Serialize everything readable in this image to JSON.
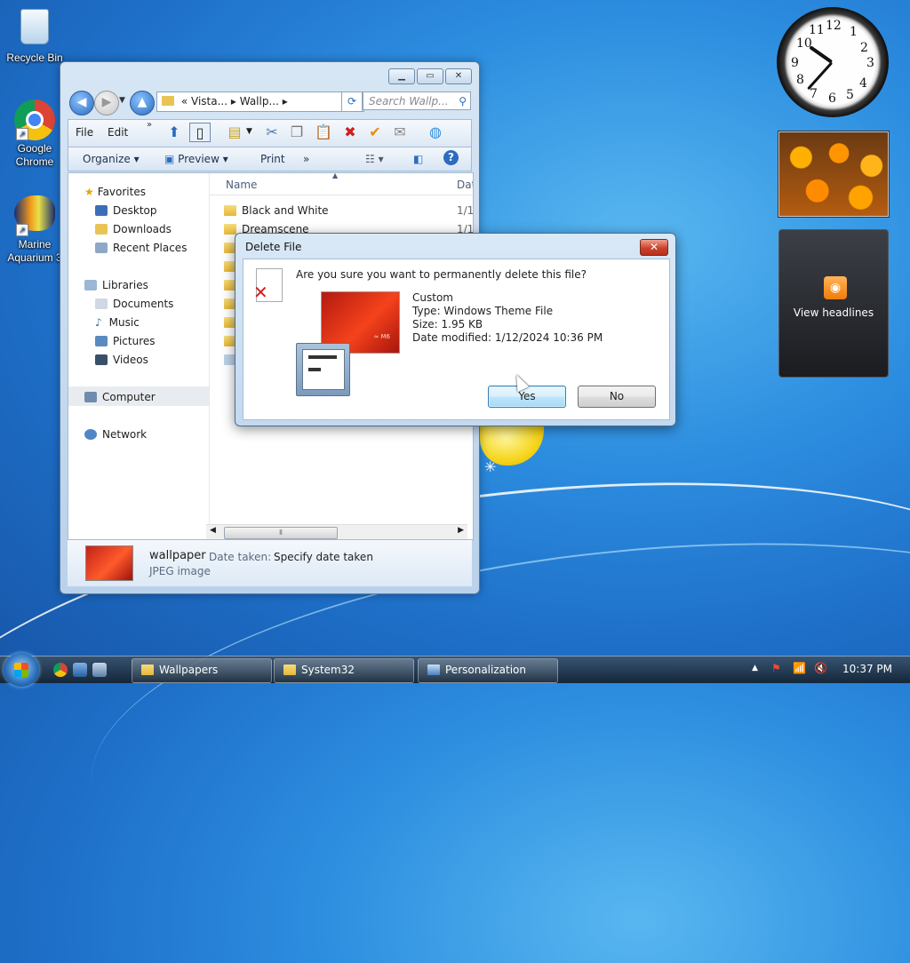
{
  "desktop": {
    "icons": [
      {
        "label": "Recycle Bin"
      },
      {
        "label": "Google Chrome"
      },
      {
        "label": "Marine Aquarium 3"
      }
    ]
  },
  "explorer": {
    "address_parts": [
      "«",
      "Vista...",
      "▸",
      "Wallp...",
      "▸"
    ],
    "search_placeholder": "Search Wallp...",
    "menu": {
      "file": "File",
      "edit": "Edit"
    },
    "commands": {
      "organize": "Organize",
      "preview": "Preview",
      "print": "Print",
      "more": "»"
    },
    "nav": {
      "favorites": "Favorites",
      "favorite_items": [
        "Desktop",
        "Downloads",
        "Recent Places"
      ],
      "libraries": "Libraries",
      "library_items": [
        "Documents",
        "Music",
        "Pictures",
        "Videos"
      ],
      "computer": "Computer",
      "network": "Network"
    },
    "columns": {
      "name": "Name",
      "date": "Dat"
    },
    "files": [
      {
        "name": "Black and White",
        "date": "1/1"
      },
      {
        "name": "Dreamscene",
        "date": "1/1"
      }
    ],
    "details": {
      "name": "wallpaper",
      "type": "JPEG image",
      "date_label": "Date taken:",
      "date_value": "Specify date taken"
    }
  },
  "dialog": {
    "title": "Delete File",
    "close": "✕",
    "question": "Are you sure you want to permanently delete this file?",
    "preview_text": "≈ M6",
    "file_name": "Custom",
    "type_line": "Type: Windows Theme File",
    "size_line": "Size: 1.95 KB",
    "date_line": "Date modified: 1/12/2024 10:36 PM",
    "yes": "Yes",
    "no": "No"
  },
  "gadgets": {
    "clock_numbers": [
      "12",
      "1",
      "2",
      "3",
      "4",
      "5",
      "6",
      "7",
      "8",
      "9",
      "10",
      "11"
    ],
    "feed_label": "View headlines"
  },
  "taskbar": {
    "tasks": [
      "Wallpapers",
      "System32",
      "Personalization"
    ],
    "time": "10:37 PM",
    "tray_arrow": "▲"
  },
  "colors": {
    "accent": "#2d8ee0",
    "close_red": "#c9432b"
  }
}
